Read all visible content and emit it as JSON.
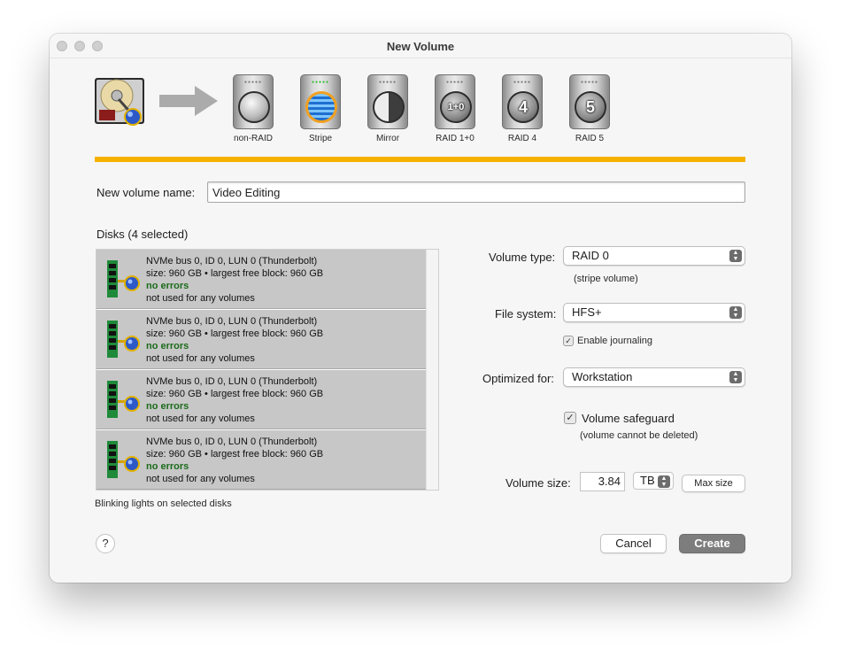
{
  "window": {
    "title": "New Volume"
  },
  "raid_options": [
    {
      "label": "non-RAID",
      "glyph": "",
      "style": "plain",
      "leds": "●●●●●"
    },
    {
      "label": "Stripe",
      "glyph": "",
      "style": "stripe",
      "leds": "●●●●●",
      "selected": true
    },
    {
      "label": "Mirror",
      "glyph": "",
      "style": "mirror",
      "leds": "●●●●●"
    },
    {
      "label": "RAID 1+0",
      "glyph": "1+0",
      "style": "r10",
      "leds": "●●●●●"
    },
    {
      "label": "RAID 4",
      "glyph": "4",
      "style": "r4",
      "leds": "●●●●●"
    },
    {
      "label": "RAID 5",
      "glyph": "5",
      "style": "r5",
      "leds": "●●●●●"
    }
  ],
  "name_field": {
    "label": "New volume name:",
    "value": "Video Editing"
  },
  "disks": {
    "header": "Disks (4 selected)",
    "items": [
      {
        "name": "NVMe bus 0, ID 0, LUN 0 (Thunderbolt)",
        "size": "size: 960 GB • largest free block: 960 GB",
        "status": "no errors",
        "usage": "not used for any volumes"
      },
      {
        "name": "NVMe bus 0, ID 0, LUN 0 (Thunderbolt)",
        "size": "size: 960 GB • largest free block: 960 GB",
        "status": "no errors",
        "usage": "not used for any volumes"
      },
      {
        "name": "NVMe bus 0, ID 0, LUN 0 (Thunderbolt)",
        "size": "size: 960 GB • largest free block: 960 GB",
        "status": "no errors",
        "usage": "not used for any volumes"
      },
      {
        "name": "NVMe bus 0, ID 0, LUN 0 (Thunderbolt)",
        "size": "size: 960 GB • largest free block: 960 GB",
        "status": "no errors",
        "usage": "not used for any volumes"
      }
    ],
    "footer": "Blinking lights on selected disks"
  },
  "volume_type": {
    "label": "Volume type:",
    "value": "RAID 0",
    "note": "(stripe volume)"
  },
  "file_system": {
    "label": "File system:",
    "value": "HFS+",
    "journaling_label": "Enable journaling",
    "journaling_checked": true
  },
  "optimized_for": {
    "label": "Optimized for:",
    "value": "Workstation"
  },
  "safeguard": {
    "label": "Volume safeguard",
    "note": "(volume cannot be deleted)",
    "checked": true
  },
  "volume_size": {
    "label": "Volume size:",
    "value": "3.84",
    "unit": "TB",
    "max_label": "Max size"
  },
  "buttons": {
    "help": "?",
    "cancel": "Cancel",
    "create": "Create"
  },
  "colors": {
    "accent_bar": "#f6b100",
    "row_bg": "#c7c7c7",
    "ok_text": "#1b6b1b",
    "primary_button": "#7d7d7d"
  },
  "icons": {
    "hard-drive": "hard-drive-icon",
    "arrow": "arrow-right-icon",
    "disk": "nvme-disk-icon",
    "popup": "chevron-updown-icon",
    "check": "checkmark-icon"
  }
}
